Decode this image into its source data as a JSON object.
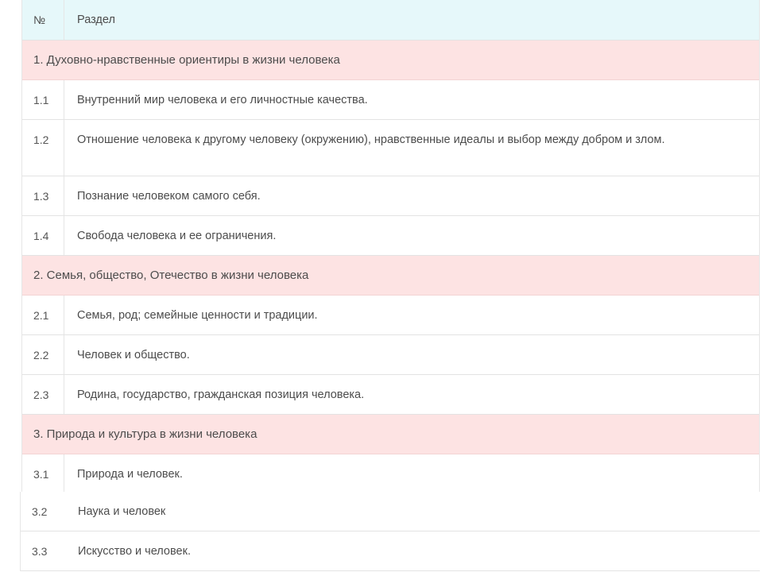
{
  "header": {
    "num": "№",
    "section": "Раздел"
  },
  "groups": [
    {
      "title": "1. Духовно-нравственные ориентиры в жизни человека",
      "items": [
        {
          "num": "1.1",
          "text": "Внутренний мир человека и его личностные качества."
        },
        {
          "num": "1.2",
          "text": "Отношение человека к другому человеку (окружению), нравственные идеалы и выбор между добром и злом."
        },
        {
          "num": "1.3",
          "text": "Познание человеком самого себя."
        },
        {
          "num": "1.4",
          "text": "Свобода человека и ее ограничения."
        }
      ]
    },
    {
      "title": "2. Семья, общество, Отечество в жизни человека",
      "items": [
        {
          "num": "2.1",
          "text": "Семья, род; семейные ценности и традиции."
        },
        {
          "num": "2.2",
          "text": "Человек и общество."
        },
        {
          "num": "2.3",
          "text": "Родина, государство, гражданская позиция человека."
        }
      ]
    },
    {
      "title": "3. Природа и культура в жизни человека",
      "items": [
        {
          "num": "3.1",
          "text": "Природа и человек."
        },
        {
          "num": "3.2",
          "text": "Наука и человек"
        },
        {
          "num": "3.3",
          "text": "Искусство и человек."
        }
      ]
    }
  ]
}
